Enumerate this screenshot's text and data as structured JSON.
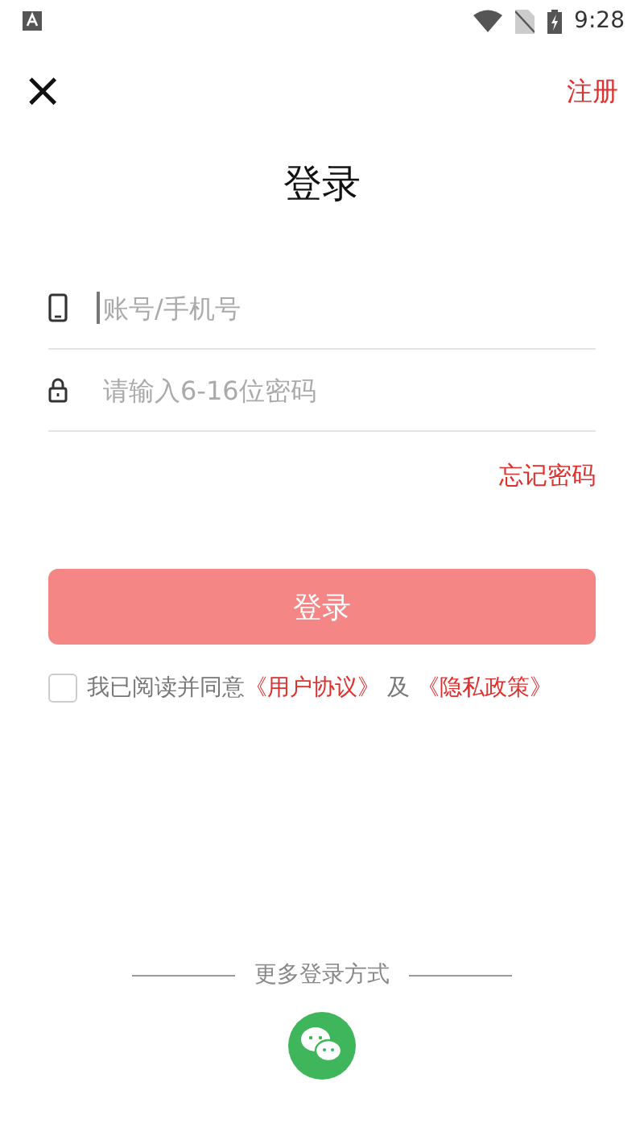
{
  "status_bar": {
    "time": "9:28"
  },
  "header": {
    "close": "×",
    "register_link": "注册"
  },
  "title": "登录",
  "fields": [
    {
      "kind": "phone",
      "placeholder": "账号/手机号",
      "focused": true
    },
    {
      "kind": "lock",
      "placeholder": "请输入6-16位密码",
      "focused": false
    }
  ],
  "forgot_link": "忘记密码",
  "login_button": {
    "label": "登录"
  },
  "agreement": {
    "checked": false,
    "prefix": "我已阅读并同意",
    "links": [
      "《用户协议》",
      "《隐私政策》"
    ],
    "conjunction": "及"
  },
  "more_login": {
    "label": "更多登录方式",
    "options": [
      {
        "kind": "wechat"
      }
    ]
  }
}
